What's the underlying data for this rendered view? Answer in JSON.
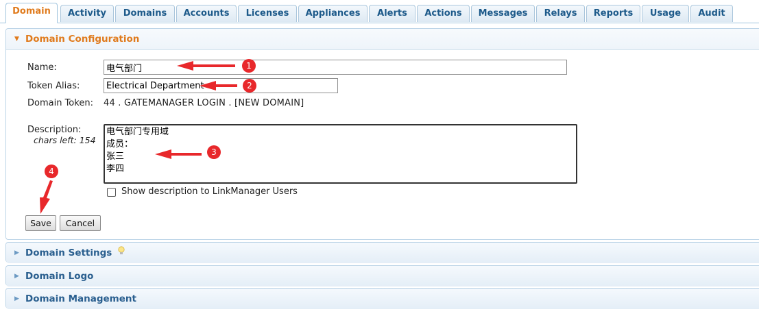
{
  "tabs": [
    {
      "label": "Domain",
      "active": true
    },
    {
      "label": "Activity"
    },
    {
      "label": "Domains"
    },
    {
      "label": "Accounts"
    },
    {
      "label": "Licenses"
    },
    {
      "label": "Appliances"
    },
    {
      "label": "Alerts"
    },
    {
      "label": "Actions"
    },
    {
      "label": "Messages"
    },
    {
      "label": "Relays"
    },
    {
      "label": "Reports"
    },
    {
      "label": "Usage"
    },
    {
      "label": "Audit"
    }
  ],
  "config": {
    "title": "Domain Configuration",
    "name_label": "Name:",
    "name_value": "电气部门",
    "alias_label": "Token Alias:",
    "alias_value": "Electrical Department",
    "token_label": "Domain Token:",
    "token_value": "44 . GATEMANAGER LOGIN . [NEW DOMAIN]",
    "desc_label": "Description:",
    "chars_left": "chars left: 154",
    "desc_value": "电气部门专用域\n成员：\n张三\n李四",
    "show_desc_label": "Show description to LinkManager Users",
    "show_desc_checked": false,
    "save_label": "Save",
    "cancel_label": "Cancel"
  },
  "sections": [
    {
      "title": "Domain Settings",
      "icon": "lightbulb-icon"
    },
    {
      "title": "Domain Logo"
    },
    {
      "title": "Domain Management"
    }
  ],
  "annotations": [
    "1",
    "2",
    "3",
    "4"
  ],
  "colors": {
    "accent": "#e07b1d",
    "link": "#2a5f8f",
    "annotation": "#e8282b"
  }
}
